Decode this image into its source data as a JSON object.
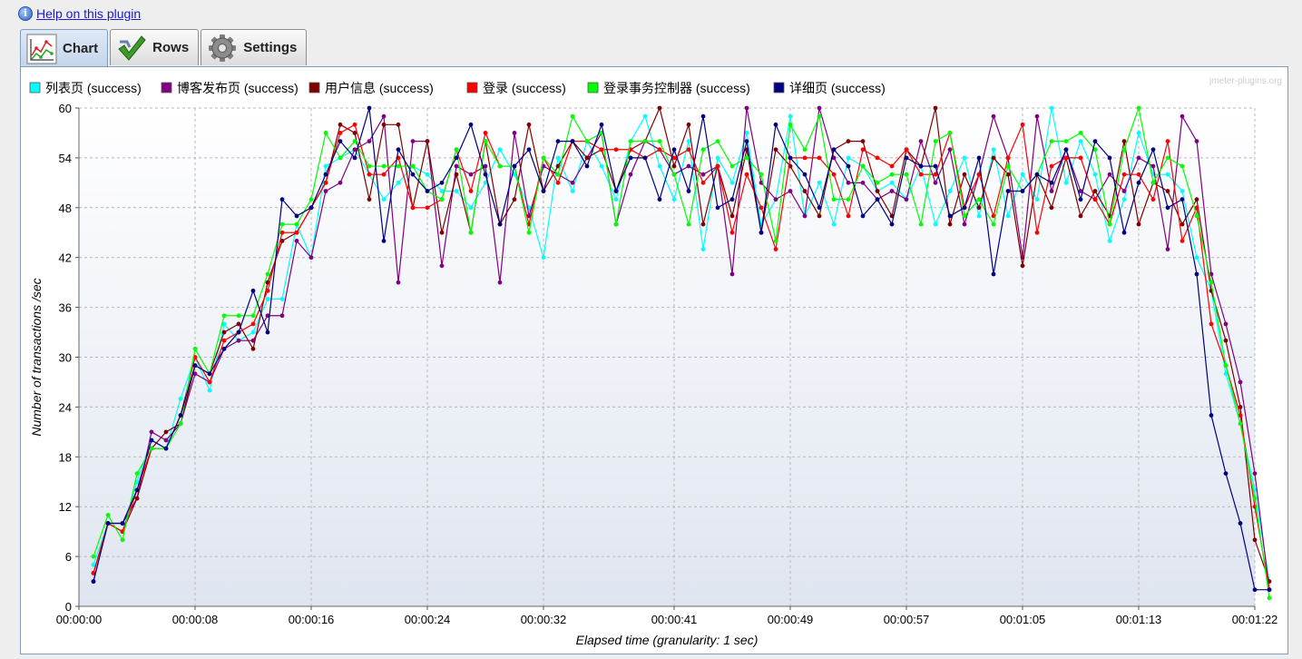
{
  "help": {
    "link": "Help on this plugin"
  },
  "tabs": [
    {
      "label": "Chart",
      "active": true
    },
    {
      "label": "Rows",
      "active": false
    },
    {
      "label": "Settings",
      "active": false
    }
  ],
  "watermark": "jmeter-plugins.org",
  "colors": {
    "cyan": "#00ffff",
    "purple": "#800080",
    "darkred": "#800000",
    "red": "#ff0000",
    "green": "#00ff00",
    "navy": "#000080"
  },
  "chart_data": {
    "type": "line",
    "xlabel": "Elapsed time (granularity: 1 sec)",
    "ylabel": "Number of transactions /sec",
    "ylim": [
      0,
      60
    ],
    "yticks": [
      "0",
      "6",
      "12",
      "18",
      "24",
      "30",
      "36",
      "42",
      "48",
      "54",
      "60"
    ],
    "xlim": [
      1,
      81
    ],
    "xtick_positions": [
      0,
      8,
      16,
      24,
      32,
      41,
      49,
      57,
      65,
      73,
      81
    ],
    "xtick_labels": [
      "00:00:00",
      "00:00:08",
      "00:00:16",
      "00:00:24",
      "00:00:32",
      "00:00:41",
      "00:00:49",
      "00:00:57",
      "00:01:05",
      "00:01:13",
      "00:01:22"
    ],
    "x_start": 1,
    "grid": true,
    "legend": "top",
    "series": [
      {
        "name": "列表页 (success)",
        "color": "#00ffff",
        "values": [
          5,
          10,
          9,
          15,
          20,
          19,
          25,
          30,
          26,
          34,
          32,
          33,
          37,
          37,
          46,
          42,
          53,
          54,
          55,
          52,
          49,
          51,
          53,
          52,
          50,
          50,
          48,
          51,
          55,
          52,
          48,
          42,
          54,
          50,
          56,
          53,
          49,
          56,
          59,
          53,
          49,
          56,
          43,
          54,
          51,
          57,
          46,
          49,
          59,
          47,
          51,
          46,
          54,
          53,
          50,
          51,
          49,
          53,
          46,
          50,
          54,
          47,
          55,
          47,
          52,
          49,
          60,
          51,
          56,
          52,
          44,
          49,
          57,
          52,
          52,
          50,
          42,
          38,
          28,
          22,
          14,
          3
        ]
      },
      {
        "name": "博客发布页 (success)",
        "color": "#800080",
        "values": [
          3,
          10,
          10,
          13,
          21,
          20,
          22,
          28,
          27,
          31,
          32,
          32,
          35,
          35,
          44,
          42,
          50,
          51,
          55,
          56,
          59,
          39,
          56,
          56,
          41,
          53,
          52,
          53,
          39,
          57,
          47,
          53,
          52,
          51,
          54,
          57,
          46,
          52,
          56,
          55,
          52,
          53,
          52,
          53,
          40,
          60,
          51,
          49,
          50,
          47,
          60,
          54,
          51,
          51,
          49,
          50,
          49,
          56,
          51,
          55,
          46,
          52,
          59,
          54,
          42,
          59,
          50,
          55,
          50,
          49,
          52,
          50,
          54,
          53,
          43,
          59,
          56,
          40,
          34,
          27,
          16,
          2
        ]
      },
      {
        "name": "用户信息 (success)",
        "color": "#800000",
        "values": [
          4,
          10,
          9,
          13,
          19,
          21,
          22,
          29,
          28,
          33,
          34,
          31,
          39,
          44,
          45,
          48,
          51,
          58,
          57,
          49,
          58,
          58,
          48,
          56,
          45,
          52,
          45,
          56,
          46,
          49,
          58,
          50,
          53,
          56,
          54,
          55,
          50,
          55,
          56,
          60,
          53,
          58,
          46,
          53,
          47,
          55,
          45,
          55,
          53,
          50,
          47,
          55,
          56,
          56,
          50,
          47,
          55,
          53,
          60,
          46,
          52,
          48,
          54,
          52,
          41,
          52,
          48,
          54,
          47,
          50,
          47,
          56,
          46,
          51,
          50,
          46,
          49,
          38,
          32,
          24,
          8,
          3
        ]
      },
      {
        "name": "登录 (success)",
        "color": "#ff0000",
        "values": [
          4,
          10,
          9,
          14,
          19,
          19,
          23,
          30,
          27,
          32,
          33,
          34,
          38,
          45,
          45,
          48,
          51,
          57,
          58,
          52,
          52,
          54,
          48,
          48,
          49,
          55,
          50,
          57,
          53,
          53,
          46,
          54,
          51,
          56,
          56,
          55,
          55,
          55,
          54,
          55,
          54,
          55,
          51,
          53,
          45,
          52,
          48,
          43,
          54,
          54,
          54,
          52,
          47,
          55,
          54,
          53,
          55,
          52,
          52,
          57,
          48,
          52,
          47,
          54,
          58,
          45,
          53,
          54,
          54,
          49,
          46,
          52,
          52,
          49,
          56,
          44,
          48,
          34,
          29,
          23,
          12,
          2
        ]
      },
      {
        "name": "登录事务控制器 (success)",
        "color": "#00ff00",
        "values": [
          6,
          11,
          8,
          16,
          19,
          19,
          22,
          31,
          28,
          35,
          35,
          35,
          40,
          46,
          46,
          49,
          57,
          54,
          56,
          53,
          53,
          53,
          53,
          50,
          49,
          55,
          45,
          56,
          53,
          53,
          45,
          54,
          52,
          59,
          56,
          57,
          46,
          56,
          56,
          56,
          52,
          46,
          55,
          56,
          53,
          54,
          52,
          44,
          58,
          55,
          59,
          49,
          49,
          53,
          51,
          52,
          52,
          46,
          56,
          57,
          47,
          49,
          46,
          53,
          50,
          52,
          56,
          56,
          57,
          55,
          46,
          55,
          60,
          51,
          54,
          53,
          47,
          39,
          29,
          22,
          13,
          1
        ]
      },
      {
        "name": "详细页 (success)",
        "color": "#000080",
        "values": [
          3,
          10,
          10,
          14,
          20,
          19,
          23,
          29,
          28,
          31,
          33,
          38,
          33,
          49,
          47,
          48,
          52,
          56,
          54,
          60,
          44,
          55,
          52,
          50,
          51,
          54,
          58,
          52,
          46,
          53,
          55,
          50,
          56,
          56,
          53,
          58,
          50,
          54,
          54,
          49,
          55,
          50,
          59,
          48,
          49,
          56,
          45,
          58,
          54,
          52,
          48,
          55,
          53,
          47,
          49,
          46,
          54,
          53,
          53,
          47,
          48,
          54,
          40,
          50,
          50,
          52,
          51,
          55,
          49,
          56,
          54,
          45,
          51,
          55,
          48,
          49,
          40,
          23,
          16,
          10,
          2,
          2
        ]
      }
    ]
  }
}
